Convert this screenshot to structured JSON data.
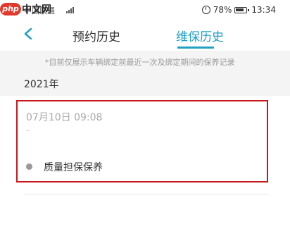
{
  "status_bar": {
    "carrier": "中国联通",
    "battery": "78%",
    "time": "13:34"
  },
  "logo": {
    "badge": "php",
    "text": "中文网"
  },
  "nav": {
    "tabs": [
      {
        "label": "预约历史",
        "active": false
      },
      {
        "label": "维保历史",
        "active": true
      }
    ],
    "accent_color": "#21a0c3"
  },
  "notice": "*目前仅展示车辆绑定前最近一次及绑定期间的保养记录",
  "records_section": {
    "year": "2021年",
    "records": [
      {
        "datetime": "07月10日 09:08",
        "subtitle": "-",
        "type": "质量担保保养"
      }
    ]
  },
  "highlight_color": "#c8161d"
}
